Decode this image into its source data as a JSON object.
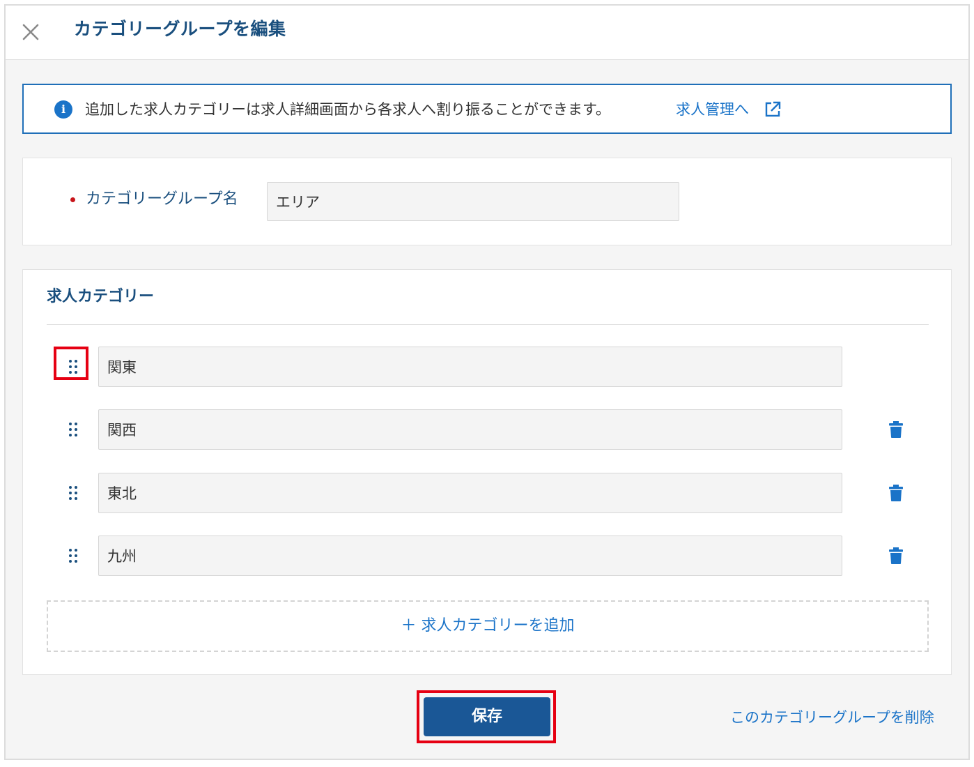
{
  "modal": {
    "title": "カテゴリーグループを編集"
  },
  "info": {
    "text": "追加した求人カテゴリーは求人詳細画面から各求人へ割り振ることができます。",
    "link_label": "求人管理へ"
  },
  "group_name": {
    "label": "カテゴリーグループ名",
    "value": "エリア"
  },
  "categories": {
    "title": "求人カテゴリー",
    "items": [
      {
        "value": "関東"
      },
      {
        "value": "関西"
      },
      {
        "value": "東北"
      },
      {
        "value": "九州"
      }
    ],
    "add_label": "＋ 求人カテゴリーを追加"
  },
  "footer": {
    "save_label": "保存",
    "delete_label": "このカテゴリーグループを削除"
  },
  "colors": {
    "brand": "#1a4f7e",
    "link": "#1a73c8",
    "primary_button": "#1a5796",
    "required": "#c8151b",
    "highlight": "#e60012"
  }
}
